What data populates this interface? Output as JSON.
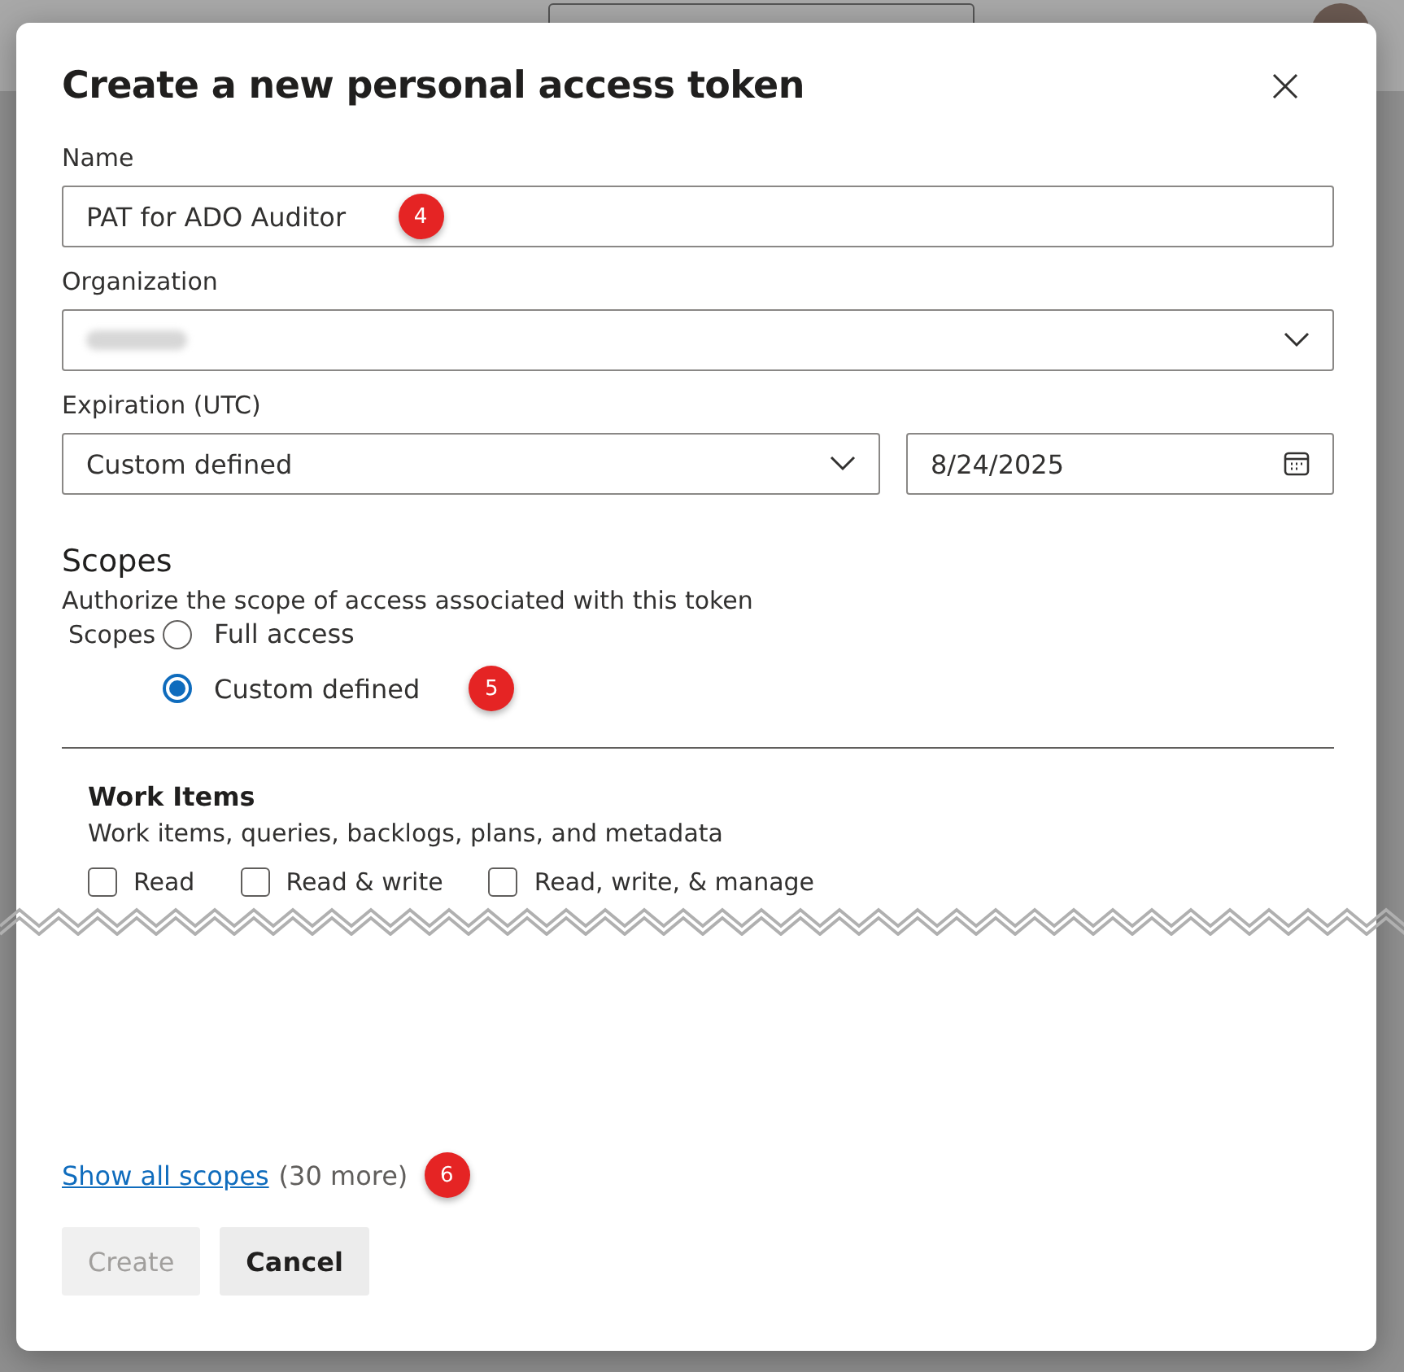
{
  "dialog": {
    "title": "Create a new personal access token",
    "name_field": {
      "label": "Name",
      "value": "PAT for ADO Auditor",
      "annotation": "4"
    },
    "organization_field": {
      "label": "Organization",
      "redacted": true
    },
    "expiration": {
      "label": "Expiration (UTC)",
      "preset": "Custom defined",
      "date": "8/24/2025"
    },
    "scopes": {
      "heading": "Scopes",
      "description": "Authorize the scope of access associated with this token",
      "group_label": "Scopes",
      "annotation": "5",
      "options": [
        {
          "label": "Full access",
          "selected": false
        },
        {
          "label": "Custom defined",
          "selected": true
        }
      ]
    },
    "scope_section": {
      "title": "Work Items",
      "description": "Work items, queries, backlogs, plans, and metadata",
      "permissions": [
        {
          "label": "Read",
          "checked": false
        },
        {
          "label": "Read & write",
          "checked": false
        },
        {
          "label": "Read, write, & manage",
          "checked": false
        }
      ]
    },
    "show_all": {
      "link": "Show all scopes",
      "count": "(30 more)",
      "annotation": "6"
    },
    "buttons": [
      {
        "label": "Create",
        "disabled": true
      },
      {
        "label": "Cancel",
        "disabled": false
      }
    ]
  }
}
